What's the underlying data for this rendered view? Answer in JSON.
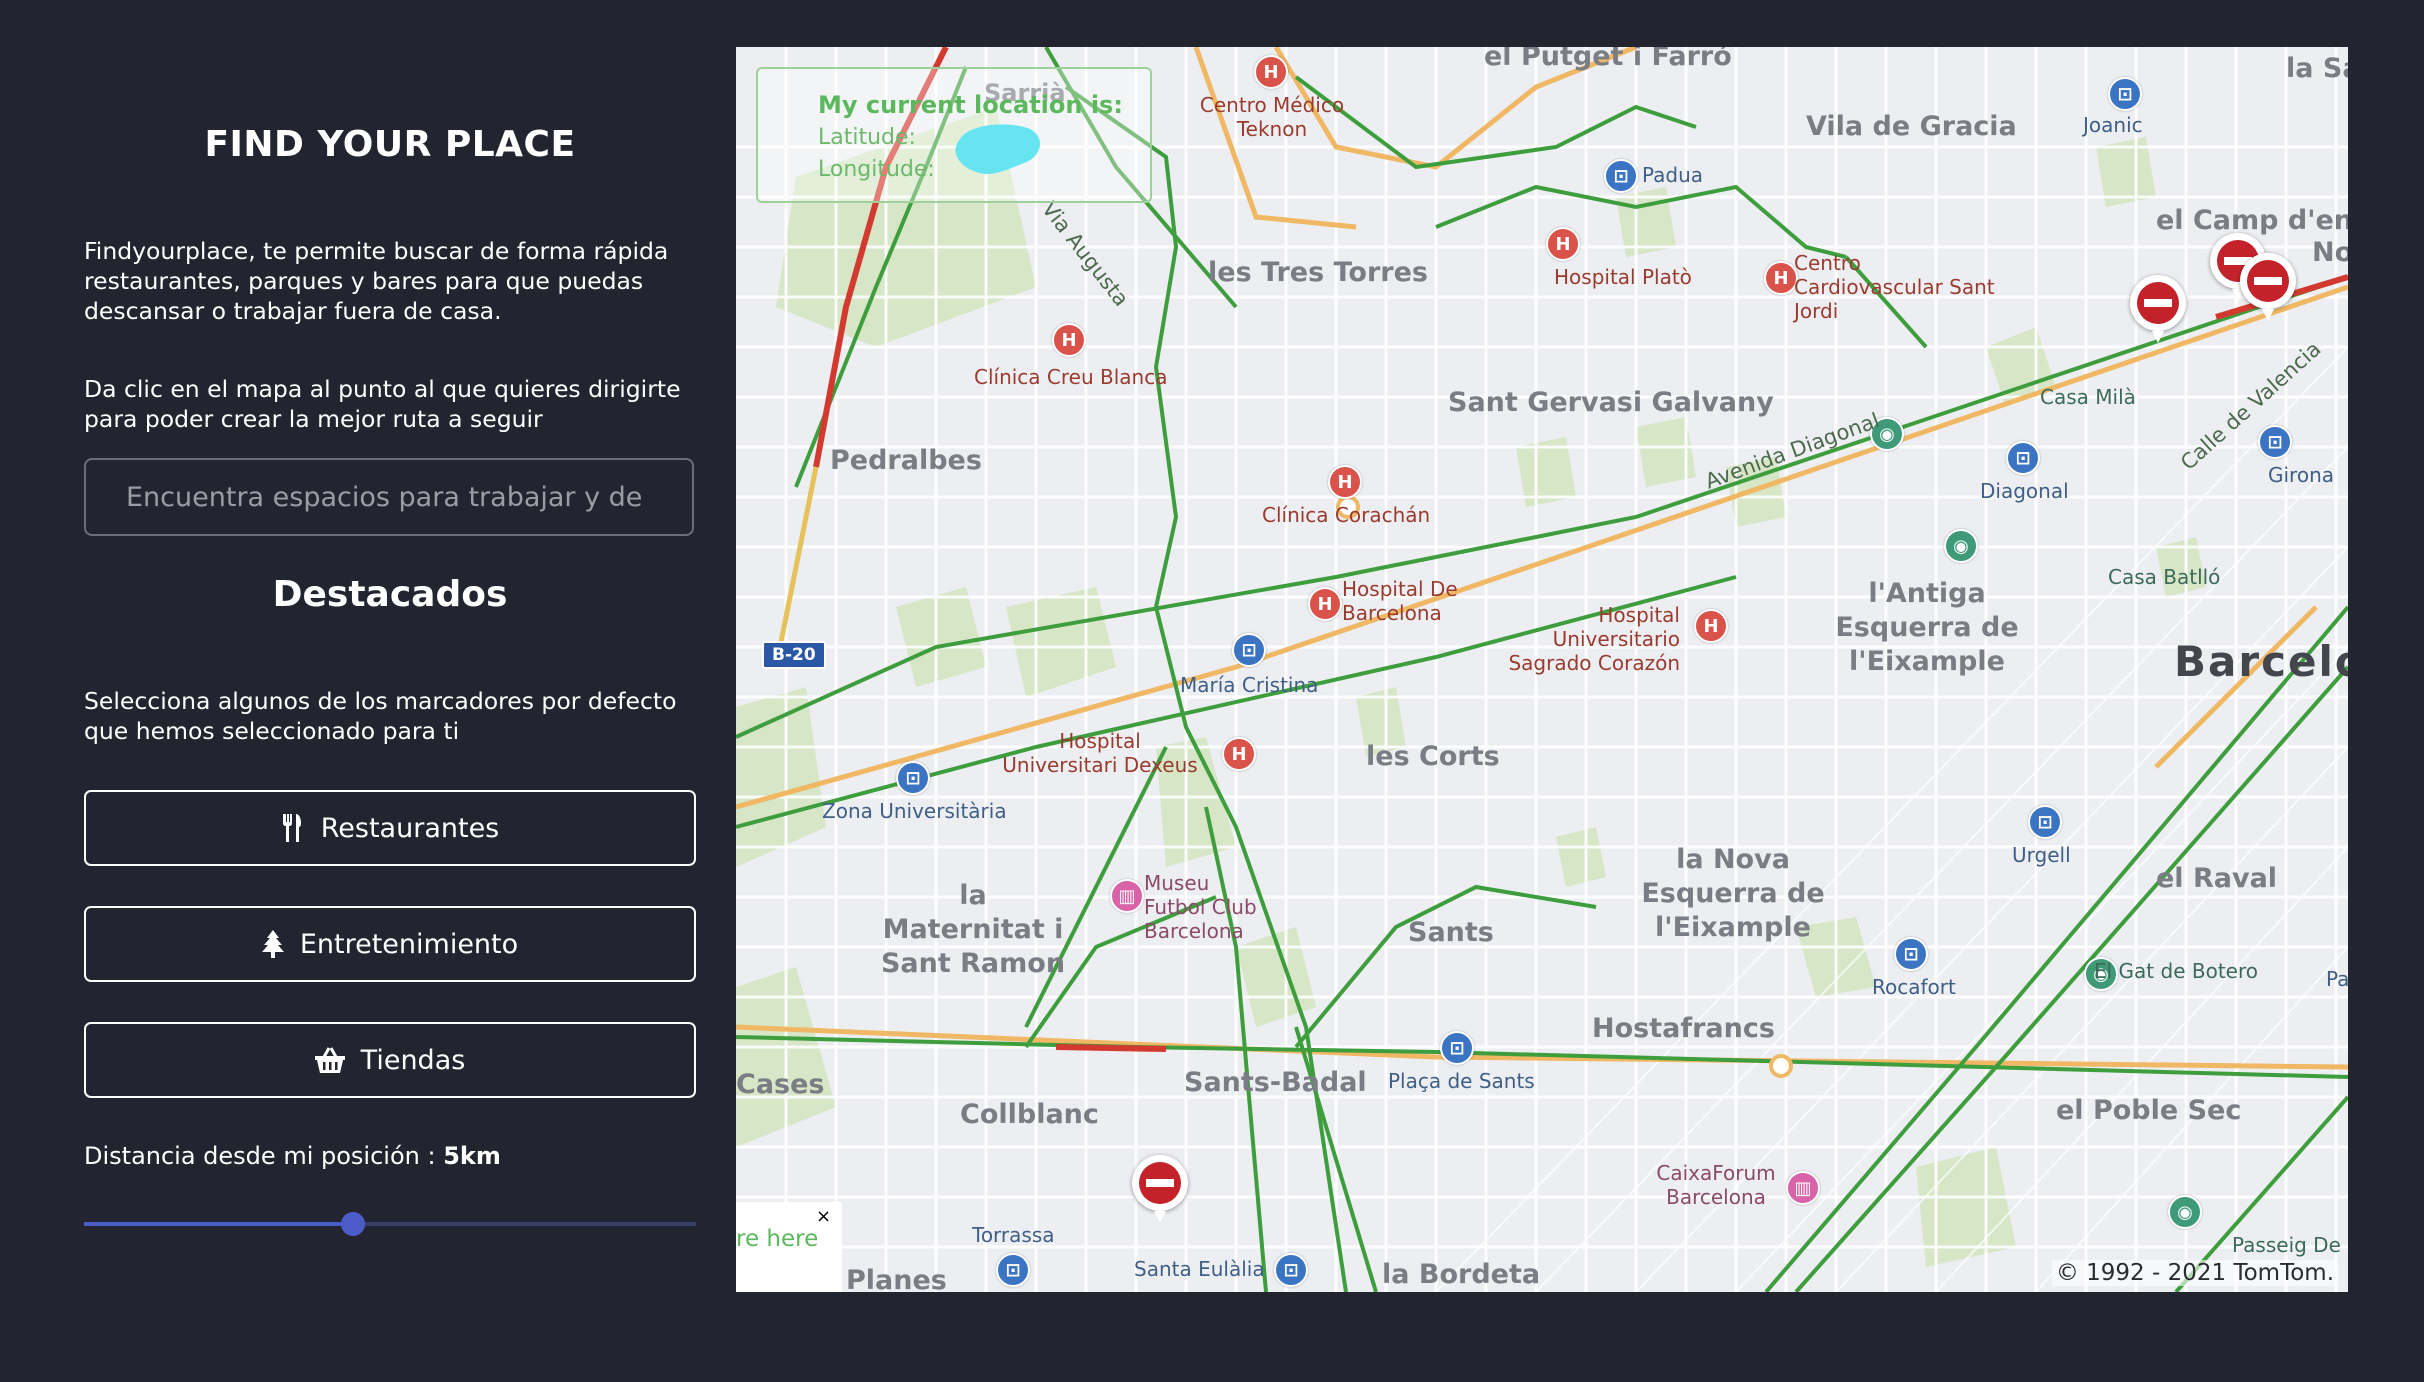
{
  "sidebar": {
    "title": "FIND YOUR PLACE",
    "intro": "Findyourplace, te permite buscar de forma rápida restaurantes, parques y bares para que puedas descansar o trabajar fuera de casa.",
    "instructions": "Da clic en el mapa al punto al que quieres dirigirte para poder crear la mejor ruta a seguir",
    "search_placeholder": "Encuentra espacios para trabajar y de",
    "featured_title": "Destacados",
    "featured_desc": "Selecciona algunos de los marcadores por defecto que hemos seleccionado para ti",
    "buttons": [
      {
        "label": "Restaurantes",
        "icon": "utensils-icon"
      },
      {
        "label": "Entretenimiento",
        "icon": "tree-icon"
      },
      {
        "label": "Tiendas",
        "icon": "basket-icon"
      }
    ],
    "distance_label": "Distancia desde mi posición :",
    "distance_value": "5km",
    "slider_fraction": 0.44,
    "accent": "#4b5cc8"
  },
  "map": {
    "location_box": {
      "title": "My current location is:",
      "latitude_label": "Latitude:",
      "longitude_label": "Longitude:"
    },
    "popup_text": "re here",
    "popup_close": "×",
    "copyright": "© 1992 - 2021 TomTom.",
    "areas": [
      "el Putget i Farró",
      "Vila de Gracia",
      "les Tres Torres",
      "Sant Gervasi Galvany",
      "Pedralbes",
      "l'Antiga Esquerra de l'Eixample",
      "les Corts",
      "la Nova Esquerra de l'Eixample",
      "la Maternitat i Sant Ramon",
      "Sants",
      "Hostafrancs",
      "Sants-Badal",
      "Collblanc",
      "el Poble Sec",
      "el Raval",
      "Cases",
      "Planes",
      "la Bordeta",
      "el Camp d'en Gr",
      "la Sa",
      "Sarrià"
    ],
    "city": "Barcelon",
    "pois": [
      "Centro Médico Teknon",
      "Hospital Platò",
      "Centro Cardiovascular Sant Jordi",
      "Clínica Creu Blanca",
      "Clínica Corachán",
      "Hospital De Barcelona",
      "Hospital Universitario Sagrado Corazón",
      "Hospital Universitari Dexeus",
      "Museu Futbol Club Barcelona",
      "CaixaForum Barcelona",
      "Casa Milà",
      "Casa Batlló",
      "El Gat de Botero",
      "Passeig De Miram"
    ],
    "transit": [
      "Padua",
      "Joanic",
      "Diagonal",
      "Girona",
      "María Cristina",
      "Zona Universitària",
      "Urgell",
      "Rocafort",
      "Plaça de Sants",
      "Santa Eulàlia",
      "Torrassa",
      "Pa"
    ],
    "streets": [
      "Via Augusta",
      "Avenida Diagonal",
      "Calle de Valencia"
    ],
    "road_shield": "B-20",
    "nov": "Nov"
  }
}
